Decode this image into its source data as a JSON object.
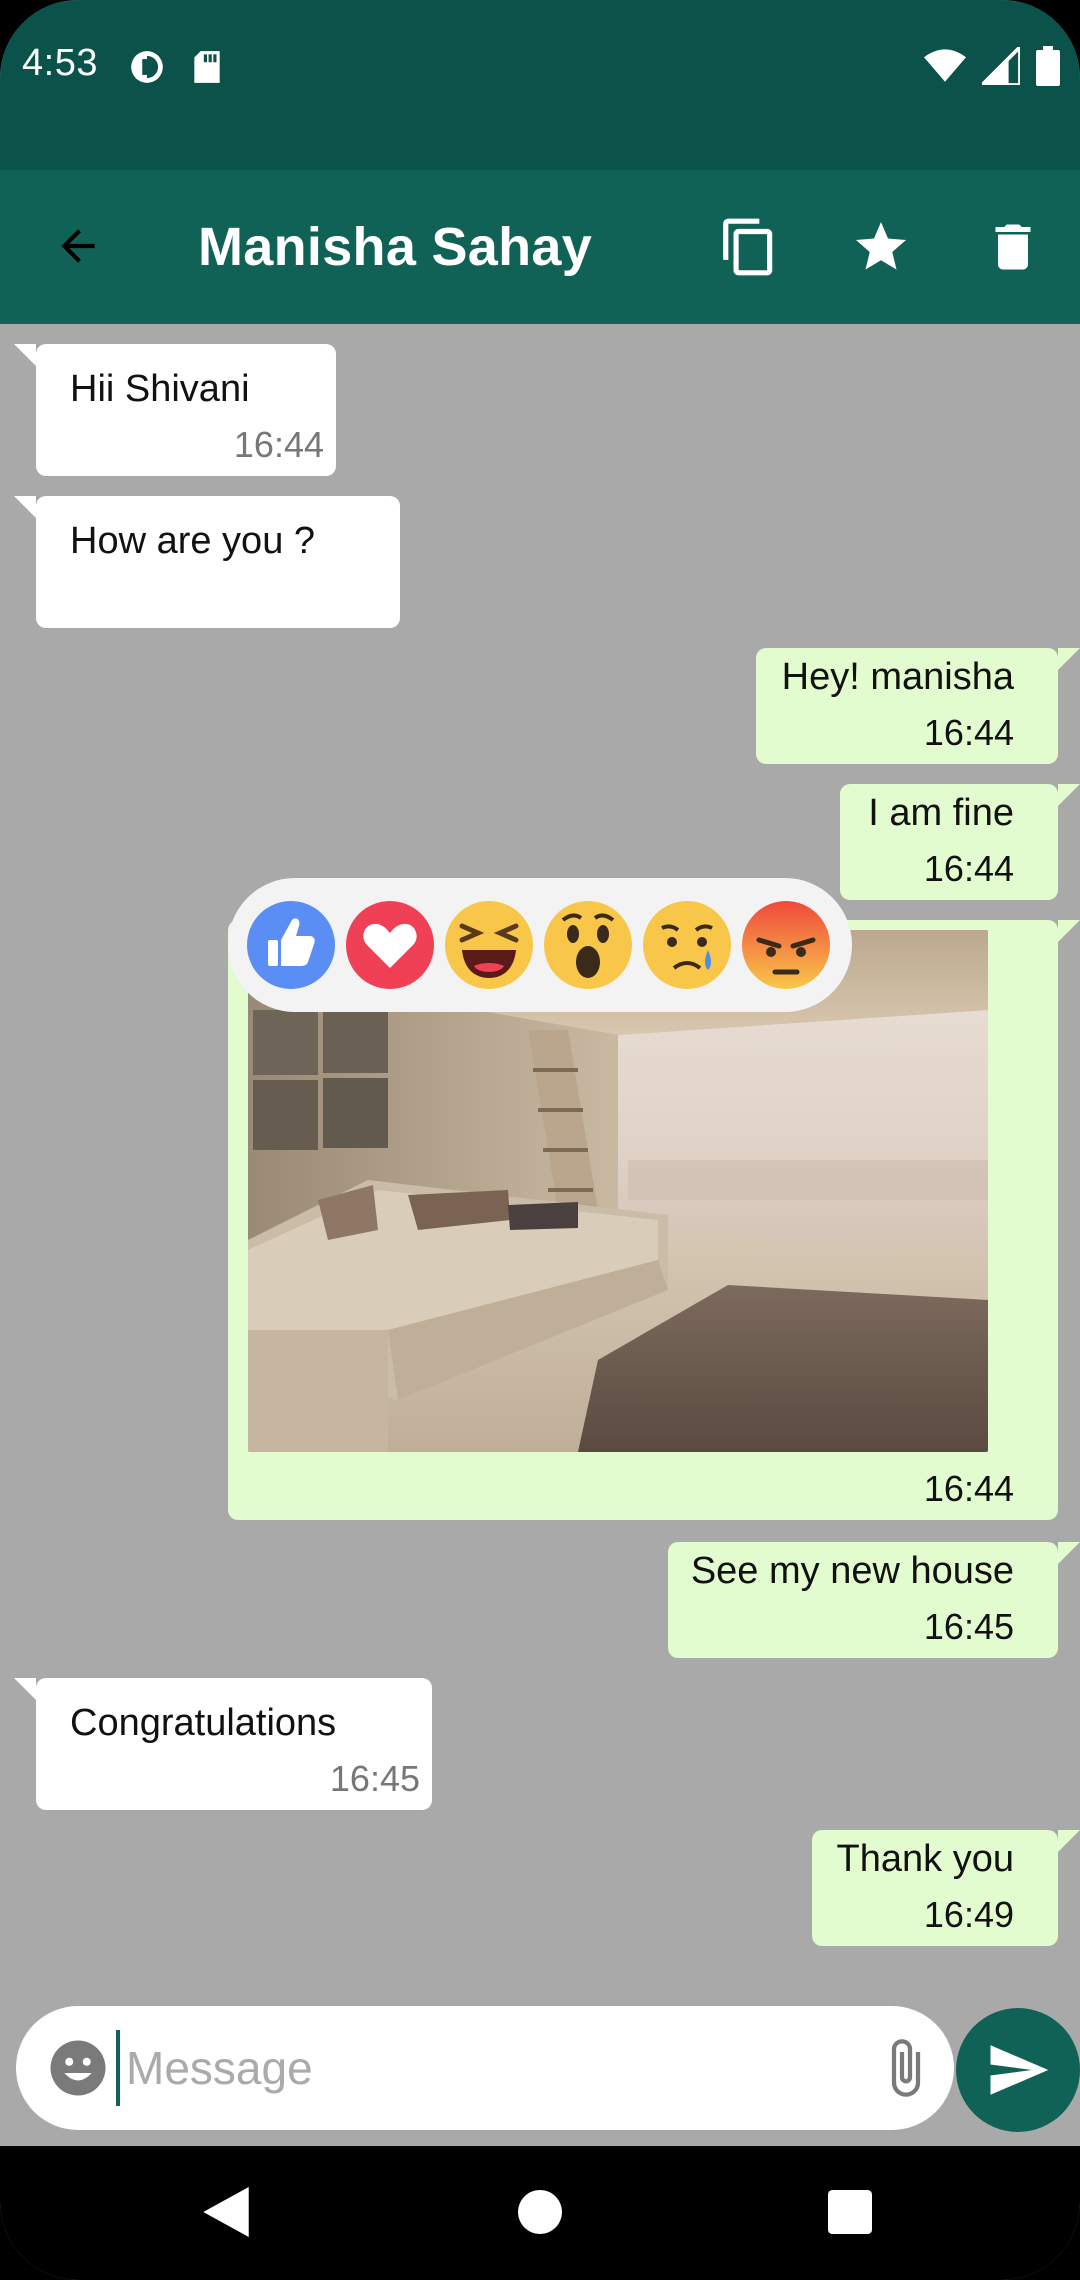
{
  "status_bar": {
    "time": "4:53",
    "icons": [
      "data-saver-icon",
      "sd-card-icon",
      "wifi-icon",
      "signal-icon",
      "battery-icon"
    ]
  },
  "header": {
    "contact_name": "Manisha Sahay",
    "actions": [
      "back-icon",
      "copy-icon",
      "star-icon",
      "delete-icon"
    ]
  },
  "messages": [
    {
      "direction": "incoming",
      "text": "Hii Shivani",
      "time": "16:44"
    },
    {
      "direction": "incoming",
      "text": "How are you ?",
      "time": ""
    },
    {
      "direction": "outgoing",
      "text": "Hey! manisha",
      "time": "16:44"
    },
    {
      "direction": "outgoing",
      "text": "I am fine",
      "time": "16:44"
    },
    {
      "direction": "outgoing",
      "type": "image",
      "time": "16:44"
    },
    {
      "direction": "outgoing",
      "text": "See my new house",
      "time": "16:45"
    },
    {
      "direction": "incoming",
      "text": "Congratulations",
      "time": "16:45"
    },
    {
      "direction": "outgoing",
      "text": "Thank you",
      "time": "16:49"
    }
  ],
  "reactions": [
    "like",
    "love",
    "haha",
    "wow",
    "sad",
    "angry"
  ],
  "composer": {
    "placeholder": "Message",
    "value": ""
  },
  "colors": {
    "status_bar": "#0b534a",
    "toolbar": "#106257",
    "chat_background": "#a9a9a9",
    "outgoing_bubble": "#e2fbcf",
    "incoming_bubble": "#ffffff"
  }
}
